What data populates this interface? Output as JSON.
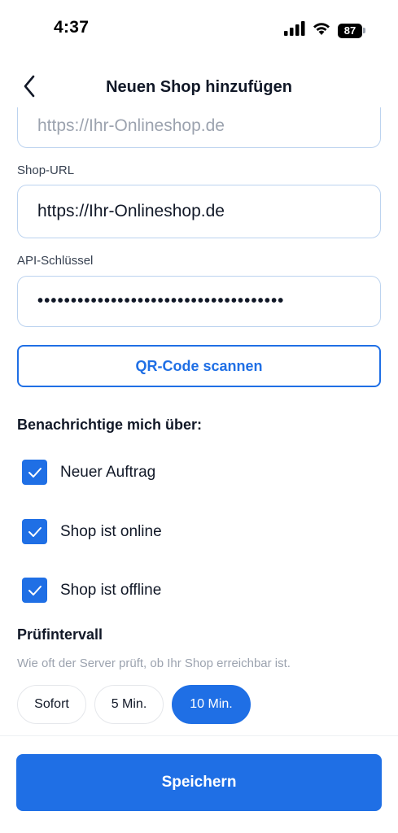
{
  "status_bar": {
    "time": "4:37",
    "battery": "87",
    "icons": [
      "signal-icon",
      "wifi-icon",
      "battery-icon"
    ]
  },
  "nav": {
    "title": "Neuen Shop hinzufügen",
    "back_icon": "chevron-left-icon"
  },
  "form": {
    "partial_field_placeholder": "https://Ihr-Onlineshop.de",
    "shop_url_label": "Shop-URL",
    "shop_url_value": "https://Ihr-Onlineshop.de",
    "api_key_label": "API-Schlüssel",
    "api_key_masked": "•••••••••••••••••••••••••••••••••••••",
    "qr_button_label": "QR-Code scannen"
  },
  "notifications": {
    "heading": "Benachrichtige mich über:",
    "items": [
      {
        "label": "Neuer Auftrag",
        "checked": true
      },
      {
        "label": "Shop ist online",
        "checked": true
      },
      {
        "label": "Shop ist offline",
        "checked": true
      }
    ]
  },
  "interval": {
    "heading": "Prüfintervall",
    "description": "Wie oft der Server prüft, ob Ihr Shop erreichbar ist.",
    "options": [
      {
        "label": "Sofort",
        "selected": false
      },
      {
        "label": "5 Min.",
        "selected": false
      },
      {
        "label": "10 Min.",
        "selected": true
      }
    ]
  },
  "footer": {
    "save_label": "Speichern"
  },
  "colors": {
    "accent": "#1f6fe5",
    "input_border": "#bcd3ef",
    "muted_text": "#9ca3af"
  }
}
